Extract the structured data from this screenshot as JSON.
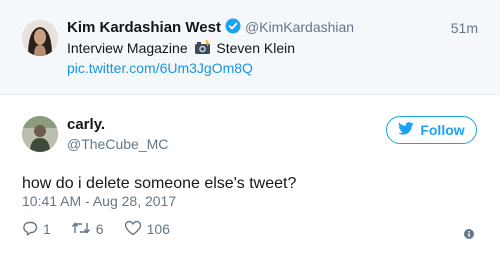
{
  "quoted_tweet": {
    "author_name": "Kim Kardashian West",
    "author_handle": "@KimKardashian",
    "time": "51m",
    "text_before_icon": "Interview Magazine",
    "text_after_icon": "Steven Klein",
    "icon": "camera-with-flash-icon",
    "link": "pic.twitter.com/6Um3JgOm8Q"
  },
  "tweet": {
    "author_name": "carly.",
    "author_handle": "@TheCube_MC",
    "follow_label": "Follow",
    "text": "how do i delete someone else's tweet?",
    "date": "10:41 AM - Aug 28, 2017",
    "replies": "1",
    "retweets": "6",
    "likes": "106"
  },
  "colors": {
    "accent": "#1da1f2",
    "link": "#1b95e0",
    "muted": "#657786",
    "quoted_background": "#f5f8fa"
  }
}
